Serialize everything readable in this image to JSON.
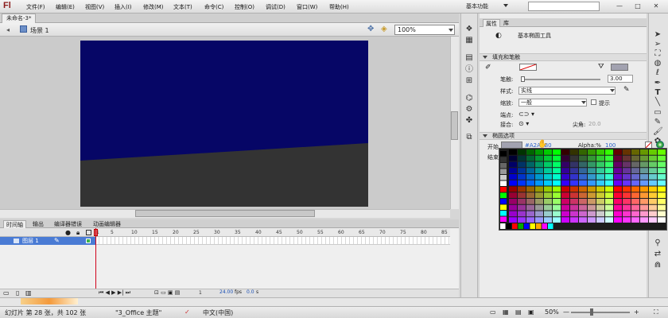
{
  "app": {
    "logo": "Fl",
    "workspace": "基本功能",
    "window_buttons": [
      "—",
      "□",
      "✕"
    ]
  },
  "menu": [
    "文件(F)",
    "编辑(E)",
    "视图(V)",
    "插入(I)",
    "修改(M)",
    "文本(T)",
    "命令(C)",
    "控制(O)",
    "调试(D)",
    "窗口(W)",
    "帮助(H)"
  ],
  "document": {
    "tab": "未命名-3*",
    "scene": "场景 1",
    "zoom": "100%"
  },
  "timeline": {
    "tabs": [
      "时间轴",
      "输出",
      "编译器错误",
      "动画编辑器"
    ],
    "layer": "图层 1",
    "ruler": [
      "1",
      "5",
      "10",
      "15",
      "20",
      "25",
      "30",
      "35",
      "40",
      "45",
      "50",
      "55",
      "60",
      "65",
      "70",
      "75",
      "80",
      "85"
    ],
    "status": {
      "frame": "1",
      "fps": "24.00",
      "fps_unit": "fps",
      "time": "0.0",
      "time_unit": "s"
    }
  },
  "properties": {
    "tabs": [
      "属性",
      "库"
    ],
    "tool_name": "基本椭圆工具",
    "fill_stroke": {
      "header": "填充和笔触",
      "stroke_label": "笔触:",
      "stroke_value": "3.00",
      "style_label": "样式:",
      "style_value": "实线",
      "scale_label": "缩放:",
      "scale_value": "一般",
      "hint_label": "提示",
      "cap_label": "端点:",
      "join_label": "接合:",
      "miter_label": "尖角:",
      "miter_value": "20.0"
    },
    "ellipse": {
      "header": "椭圆选项",
      "start_label": "开始",
      "end_label": "结束",
      "hex_value": "#A2A2B0",
      "alpha_label": "Alpha:%",
      "alpha_value": "100"
    }
  },
  "statusbar": {
    "slide": "幻灯片 第 28 张，共 102 张",
    "theme": "\"3_Office 主题\"",
    "language": "中文(中国)",
    "zoom": "50%",
    "minus": "—",
    "plus": "+"
  },
  "colors": {
    "stage_sky": "#060666",
    "stage_ground": "#333333",
    "fill_swatch": "#a2a2b0"
  }
}
